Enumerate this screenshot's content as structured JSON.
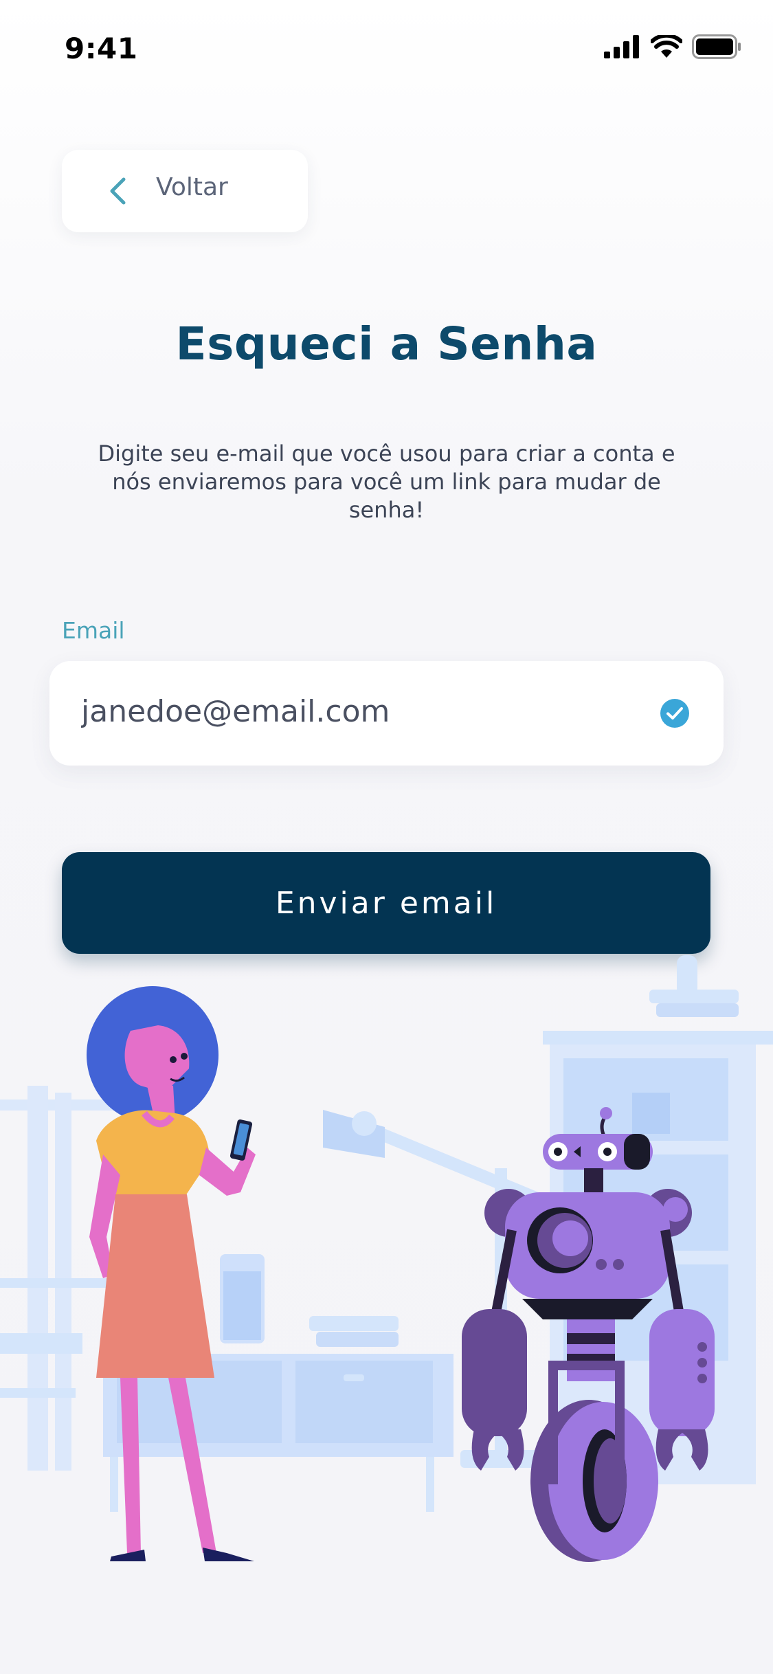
{
  "status_bar": {
    "time": "9:41",
    "icons": [
      "cellular-signal-icon",
      "wifi-icon",
      "battery-icon"
    ]
  },
  "header": {
    "back_label": "Voltar",
    "back_icon": "chevron-left-icon"
  },
  "main": {
    "title": "Esqueci a Senha",
    "description": "Digite seu e-mail que você usou para criar a conta e nós enviaremos para você um link para mudar de senha!",
    "email_label": "Email",
    "email_value": "janedoe@email.com",
    "email_valid_icon": "check-circle-icon",
    "submit_label": "Enviar email"
  },
  "illustration": {
    "subjects": [
      "woman-holding-phone",
      "purple-robot",
      "office-background"
    ]
  },
  "colors": {
    "title": "#0d4a6b",
    "accent": "#4aa3b8",
    "button": "#033452",
    "check": "#3aa6d8",
    "robot": "#9d78e0",
    "hair": "#4263d6"
  }
}
